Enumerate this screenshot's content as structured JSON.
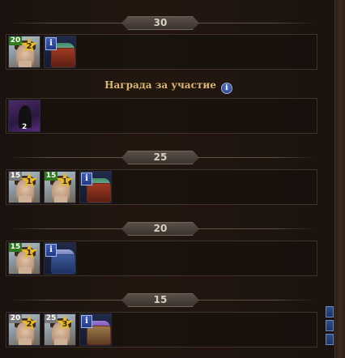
{
  "levels": {
    "l30": "30",
    "l25": "25",
    "l20": "20",
    "l15": "15"
  },
  "participation": {
    "title": "Награда за участие",
    "info": "i"
  },
  "rewards": {
    "r30": {
      "hero1": {
        "level": "20",
        "stars": "2"
      },
      "chest": {
        "info": "i"
      }
    },
    "participation": {
      "item": {
        "count": "2"
      }
    },
    "r25": {
      "hero1": {
        "level": "15",
        "stars": "1"
      },
      "hero2": {
        "level": "15",
        "stars": "1"
      },
      "chest": {
        "info": "i"
      }
    },
    "r20": {
      "hero1": {
        "level": "15",
        "stars": "1"
      },
      "chest": {
        "info": "i"
      }
    },
    "r15": {
      "hero1": {
        "level": "20",
        "stars": "2"
      },
      "hero2": {
        "level": "25",
        "stars": "3"
      },
      "chest": {
        "info": "i"
      }
    }
  },
  "colors": {
    "accent_gold": "#d9b772",
    "level_green": "#2f7a1d",
    "info_blue": "#3e5db8"
  }
}
